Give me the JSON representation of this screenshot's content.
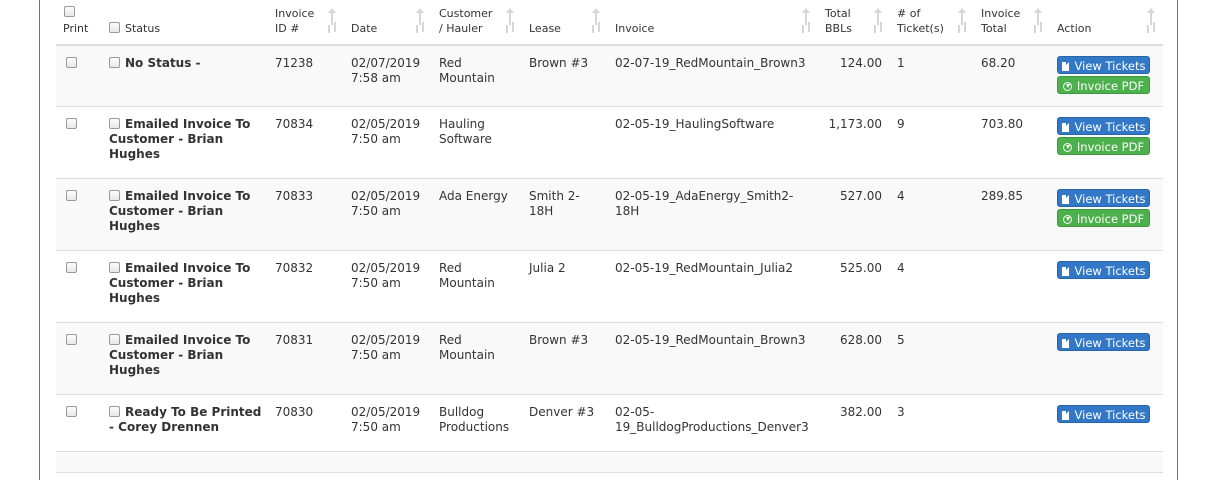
{
  "header": {
    "print": "Print",
    "status": "Status",
    "invoice_id_line1": "Invoice",
    "invoice_id_line2": "ID #",
    "date": "Date",
    "customer_line1": "Customer",
    "customer_line2": "/ Hauler",
    "lease": "Lease",
    "invoice": "Invoice",
    "total_bbls_line1": "Total",
    "total_bbls_line2": "BBLs",
    "tickets_line1": "# of",
    "tickets_line2": "Ticket(s)",
    "invoice_total_line1": "Invoice",
    "invoice_total_line2": "Total",
    "action": "Action"
  },
  "buttons": {
    "view_tickets": "View Tickets",
    "invoice_pdf": "Invoice PDF"
  },
  "rows": [
    {
      "status": "No Status -",
      "id": "71238",
      "date_line1": "02/07/2019",
      "date_line2": "7:58 am",
      "customer_line1": "Red",
      "customer_line2": "Mountain",
      "lease_line1": "Brown #3",
      "lease_line2": "",
      "invoice_line1": "02-07-19_RedMountain_Brown3",
      "invoice_line2": "",
      "bbls": "124.00",
      "tickets": "1",
      "total": "68.20",
      "has_pdf": true
    },
    {
      "status": "Emailed Invoice To Customer - Brian Hughes",
      "id": "70834",
      "date_line1": "02/05/2019",
      "date_line2": "7:50 am",
      "customer_line1": "Hauling",
      "customer_line2": "Software",
      "lease_line1": "",
      "lease_line2": "",
      "invoice_line1": "02-05-19_HaulingSoftware",
      "invoice_line2": "",
      "bbls": "1,173.00",
      "tickets": "9",
      "total": "703.80",
      "has_pdf": true
    },
    {
      "status": "Emailed Invoice To Customer - Brian Hughes",
      "id": "70833",
      "date_line1": "02/05/2019",
      "date_line2": "7:50 am",
      "customer_line1": "Ada Energy",
      "customer_line2": "",
      "lease_line1": "Smith 2-",
      "lease_line2": "18H",
      "invoice_line1": "02-05-19_AdaEnergy_Smith2-18H",
      "invoice_line2": "",
      "bbls": "527.00",
      "tickets": "4",
      "total": "289.85",
      "has_pdf": true
    },
    {
      "status": "Emailed Invoice To Customer - Brian Hughes",
      "id": "70832",
      "date_line1": "02/05/2019",
      "date_line2": "7:50 am",
      "customer_line1": "Red",
      "customer_line2": "Mountain",
      "lease_line1": "Julia 2",
      "lease_line2": "",
      "invoice_line1": "02-05-19_RedMountain_Julia2",
      "invoice_line2": "",
      "bbls": "525.00",
      "tickets": "4",
      "total": "",
      "has_pdf": false
    },
    {
      "status": "Emailed Invoice To Customer - Brian Hughes",
      "id": "70831",
      "date_line1": "02/05/2019",
      "date_line2": "7:50 am",
      "customer_line1": "Red",
      "customer_line2": "Mountain",
      "lease_line1": "Brown #3",
      "lease_line2": "",
      "invoice_line1": "02-05-19_RedMountain_Brown3",
      "invoice_line2": "",
      "bbls": "628.00",
      "tickets": "5",
      "total": "",
      "has_pdf": false
    },
    {
      "status": "Ready To Be Printed - Corey Drennen",
      "id": "70830",
      "date_line1": "02/05/2019",
      "date_line2": "7:50 am",
      "customer_line1": "Bulldog",
      "customer_line2": "Productions",
      "lease_line1": "Denver #3",
      "lease_line2": "",
      "invoice_line1": "02-05-",
      "invoice_line2": "19_BulldogProductions_Denver3",
      "bbls": "382.00",
      "tickets": "3",
      "total": "",
      "has_pdf": false
    }
  ],
  "colors": {
    "view_button": "#3278c6",
    "pdf_button": "#4cb14c",
    "panel_border": "#3d7fc0"
  }
}
